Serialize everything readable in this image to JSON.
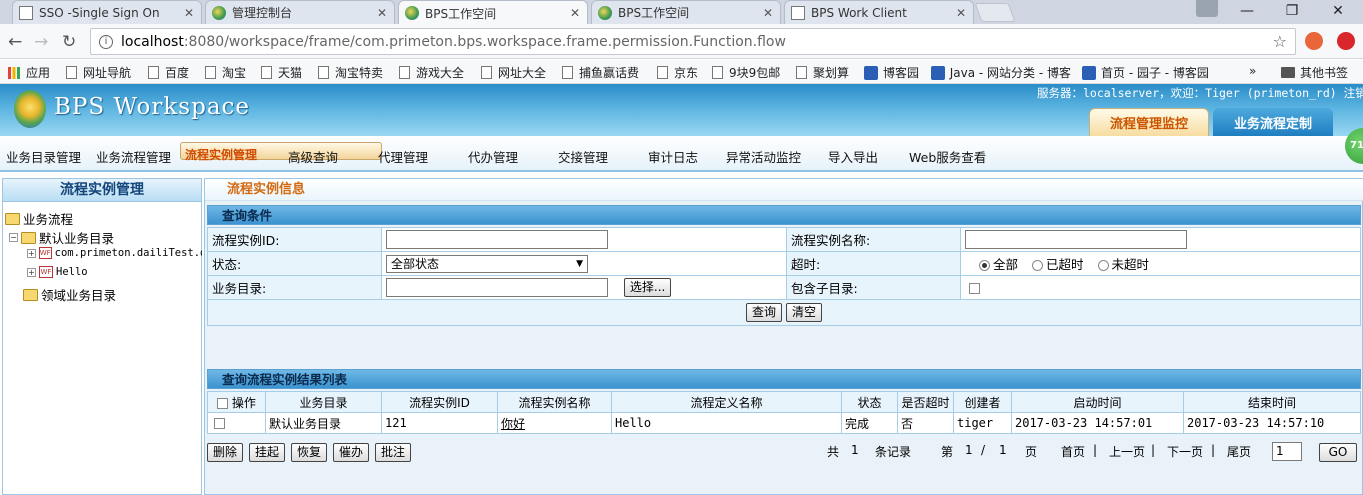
{
  "browser": {
    "tabs": [
      {
        "title": "SSO -Single Sign On",
        "icon": "page-icon"
      },
      {
        "title": "管理控制台",
        "icon": "bps-icon"
      },
      {
        "title": "BPS工作空间",
        "icon": "bps-icon",
        "active": true
      },
      {
        "title": "BPS工作空间",
        "icon": "bps-icon"
      },
      {
        "title": "BPS Work Client",
        "icon": "page-icon"
      }
    ],
    "url_host": "localhost",
    "url_rest": ":8080/workspace/frame/com.primeton.bps.workspace.frame.permission.Function.flow",
    "bookmarks": [
      "应用",
      "网址导航",
      "百度",
      "淘宝",
      "天猫",
      "淘宝特卖",
      "游戏大全",
      "网址大全",
      "捕鱼赢话费",
      "京东",
      "9块9包邮",
      "聚划算",
      "博客园",
      "Java - 网站分类 - 博客",
      "首页 - 园子 - 博客园",
      "»",
      "其他书签"
    ]
  },
  "app": {
    "logo_text": "BPS Workspace",
    "user_info": {
      "prefix": "服务器：localserver，欢迎：Tiger (primeton_rd) ",
      "logout": "注销"
    },
    "top_tabs": [
      "流程管理监控",
      "业务流程定制"
    ],
    "badge": "71",
    "menu": [
      "业务目录管理",
      "业务流程管理",
      "流程实例管理",
      "高级查询",
      "代理管理",
      "代办管理",
      "交接管理",
      "审计日志",
      "异常活动监控",
      "导入导出",
      "Web服务查看"
    ],
    "selected_menu": 2
  },
  "sidebar": {
    "title": "流程实例管理",
    "tree": {
      "root": "业务流程",
      "default_dir": "默认业务目录",
      "flows": [
        "com.primeton.dailiTest.d",
        "Hello"
      ],
      "domain_dir": "领域业务目录"
    }
  },
  "main": {
    "title": "流程实例信息",
    "query": {
      "title": "查询条件",
      "id_label": "流程实例ID:",
      "name_label": "流程实例名称:",
      "state_label": "状态:",
      "state_value": "全部状态",
      "timeout_label": "超时:",
      "timeout_options": [
        "全部",
        "已超时",
        "未超时"
      ],
      "timeout_selected": 0,
      "dir_label": "业务目录:",
      "choose_button": "选择...",
      "include_sub_label": "包含子目录:",
      "query_button": "查询",
      "clear_button": "清空"
    },
    "results": {
      "title": "查询流程实例结果列表",
      "columns": [
        "操作",
        "业务目录",
        "流程实例ID",
        "流程实例名称",
        "流程定义名称",
        "状态",
        "是否超时",
        "创建者",
        "启动时间",
        "结束时间"
      ],
      "rows": [
        [
          "",
          "默认业务目录",
          "121",
          "你好",
          "Hello",
          "完成",
          "否",
          "tiger",
          "2017-03-23 14:57:01",
          "2017-03-23 14:57:10"
        ]
      ],
      "actions": [
        "删除",
        "挂起",
        "恢复",
        "催办",
        "批注"
      ],
      "pager": {
        "total_prefix": "共",
        "total": "1",
        "total_suffix": "条记录",
        "page_prefix": "第",
        "page": "1",
        "sep": "/",
        "pages": "1",
        "page_suffix": "页",
        "first": "首页",
        "prev": "上一页",
        "next": "下一页",
        "last": "尾页",
        "page_input": "1",
        "go": "GO"
      }
    }
  }
}
